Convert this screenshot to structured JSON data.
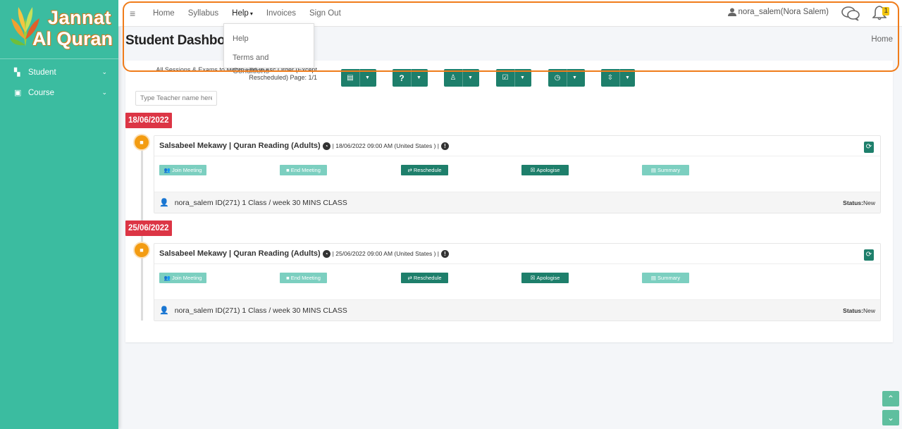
{
  "brand": {
    "line1": "Jannat",
    "line2": "Al Quran"
  },
  "sidebar": {
    "items": [
      {
        "label": "Student",
        "icon": "sitemap-icon"
      },
      {
        "label": "Course",
        "icon": "book-icon"
      }
    ]
  },
  "topnav": {
    "menu_icon": "≡",
    "items": [
      {
        "label": "Home"
      },
      {
        "label": "Syllabus"
      },
      {
        "label": "Help",
        "caret": "▾"
      },
      {
        "label": "Invoices"
      },
      {
        "label": "Sign Out"
      }
    ],
    "user": "nora_salem(Nora Salem)",
    "notifications_count": "1"
  },
  "help_dropdown": {
    "items": [
      "Help",
      "Terms and Conditions"
    ]
  },
  "page": {
    "title": "Student Dashbo",
    "breadcrumb": "Home"
  },
  "filters": {
    "summary": "All Sessions & Exams to Month End in Asc Order (Except Rescheduled) Page: 1/1",
    "teacher_placeholder": "Type Teacher name here",
    "dropdown_icons": [
      "book-icon",
      "question-icon",
      "user-icon",
      "calendar-check-icon",
      "clock-icon",
      "sort-icon"
    ]
  },
  "sessions": [
    {
      "date": "18/06/2022",
      "title": "Salsabeel Mekawy | Quran Reading (Adults)",
      "meta": "| 18/06/2022 09:00 AM (United States ) |",
      "actions": [
        {
          "label": "Join Meeting",
          "icon": "users-icon",
          "enabled": false
        },
        {
          "label": "End Meeting",
          "icon": "stop-icon",
          "enabled": false
        },
        {
          "label": "Reschedule",
          "icon": "retweet-icon",
          "enabled": true
        },
        {
          "label": "Apologise",
          "icon": "times-square-icon",
          "enabled": true
        },
        {
          "label": "Summary",
          "icon": "list-icon",
          "enabled": false
        }
      ],
      "student": "nora_salem ID(271) 1 Class / week 30 MINS CLASS",
      "status_label": "Status:",
      "status": "New"
    },
    {
      "date": "25/06/2022",
      "title": "Salsabeel Mekawy | Quran Reading (Adults)",
      "meta": "| 25/06/2022 09:00 AM (United States ) |",
      "actions": [
        {
          "label": "Join Meeting",
          "icon": "users-icon",
          "enabled": false
        },
        {
          "label": "End Meeting",
          "icon": "stop-icon",
          "enabled": false
        },
        {
          "label": "Reschedule",
          "icon": "retweet-icon",
          "enabled": true
        },
        {
          "label": "Apologise",
          "icon": "times-square-icon",
          "enabled": true
        },
        {
          "label": "Summary",
          "icon": "list-icon",
          "enabled": false
        }
      ],
      "student": "nora_salem ID(271) 1 Class / week 30 MINS CLASS",
      "status_label": "Status:",
      "status": "New"
    }
  ],
  "colors": {
    "sidebar": "#3bbca0",
    "primary": "#1e7f6b",
    "danger": "#dc3545",
    "highlight": "#f07c1a",
    "warning": "#f39c12"
  }
}
